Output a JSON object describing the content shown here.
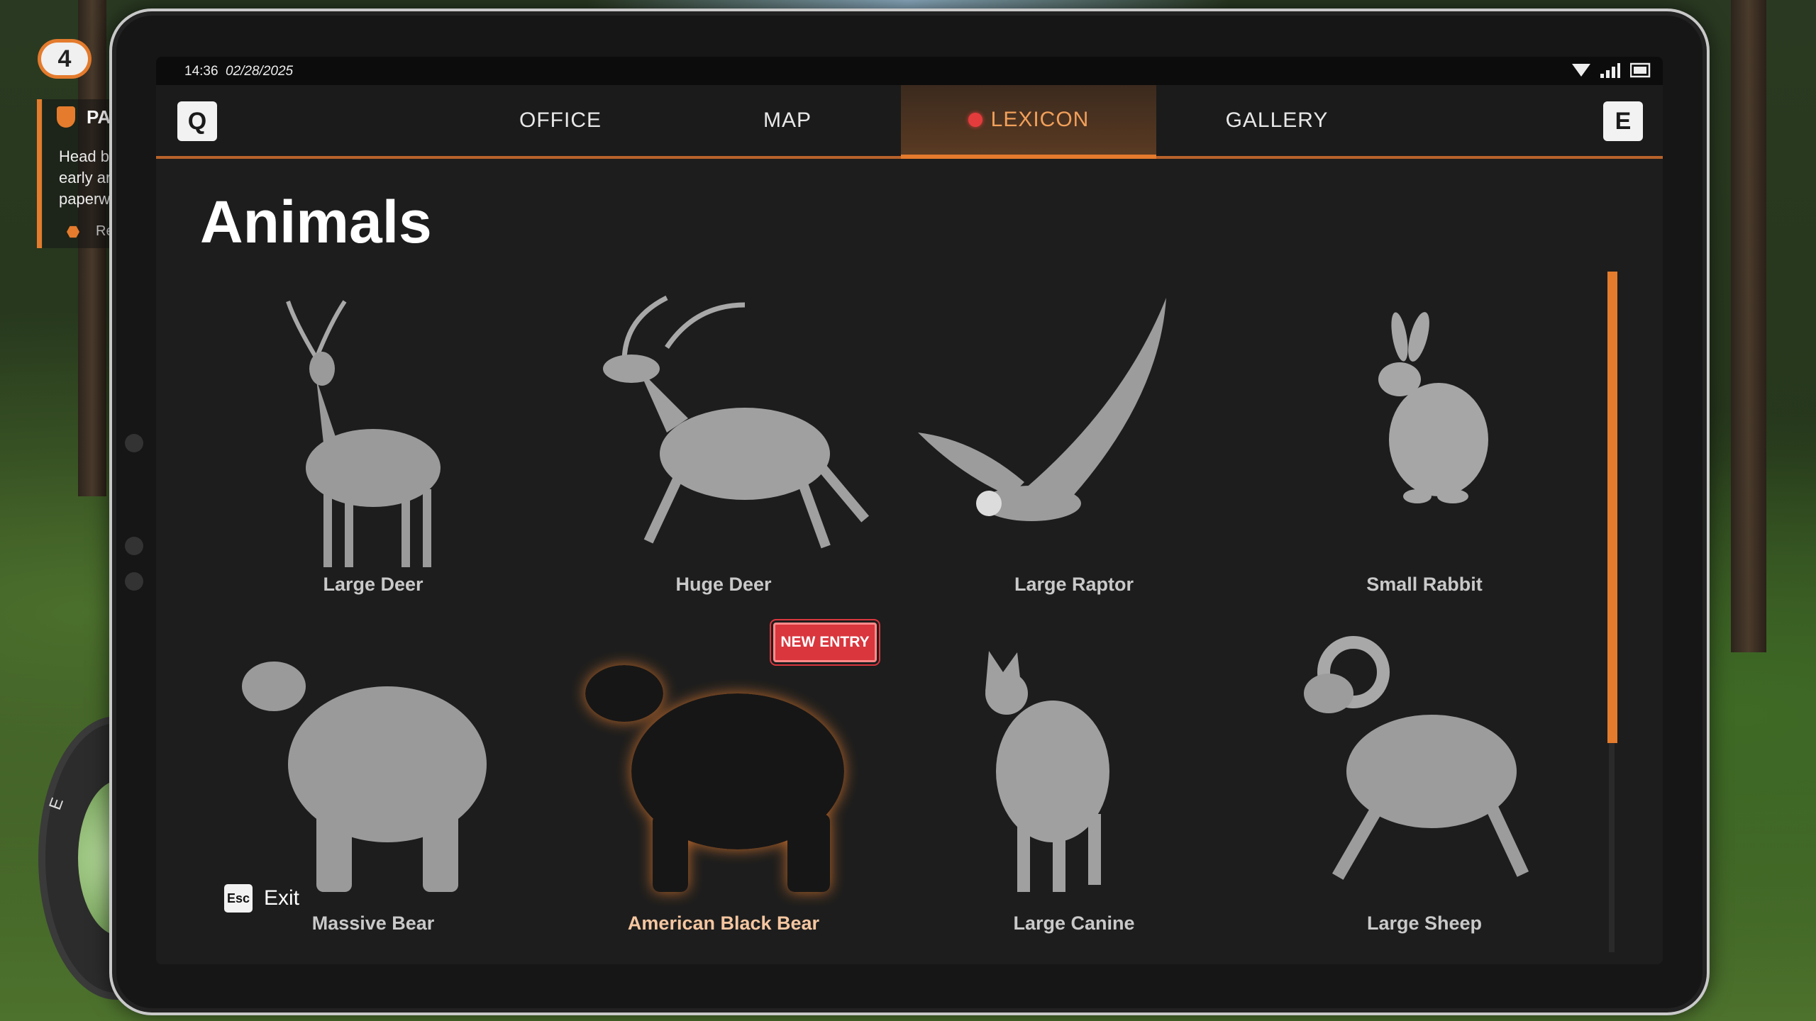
{
  "hud": {
    "quest_level": "4",
    "quest_title": "PA",
    "quest_lines": [
      "Head b",
      "early ar",
      "paperw"
    ],
    "quest_reward": "Re",
    "compass_letter": "E"
  },
  "status": {
    "time": "14:36",
    "date": "02/28/2025"
  },
  "nav": {
    "left_key": "Q",
    "right_key": "E",
    "tabs": [
      {
        "label": "OFFICE"
      },
      {
        "label": "MAP"
      },
      {
        "label": "LEXICON"
      },
      {
        "label": "GALLERY"
      }
    ],
    "active_tab": "LEXICON"
  },
  "page_title": "Animals",
  "animals": [
    {
      "label": "Large Deer",
      "icon": "large-deer-icon"
    },
    {
      "label": "Huge Deer",
      "icon": "huge-deer-icon"
    },
    {
      "label": "Large Raptor",
      "icon": "eagle-icon"
    },
    {
      "label": "Small Rabbit",
      "icon": "rabbit-icon"
    },
    {
      "label": "Massive Bear",
      "icon": "massive-bear-icon"
    },
    {
      "label": "American Black Bear",
      "icon": "black-bear-icon"
    },
    {
      "label": "Large Canine",
      "icon": "wolf-icon"
    },
    {
      "label": "Large Sheep",
      "icon": "ram-icon"
    }
  ],
  "new_entry_badge": "NEW ENTRY",
  "exit": {
    "key": "Esc",
    "label": "Exit"
  },
  "colors": {
    "accent": "#e47b2d",
    "badge": "#d9363e",
    "screen_bg": "#1d1d1d"
  }
}
